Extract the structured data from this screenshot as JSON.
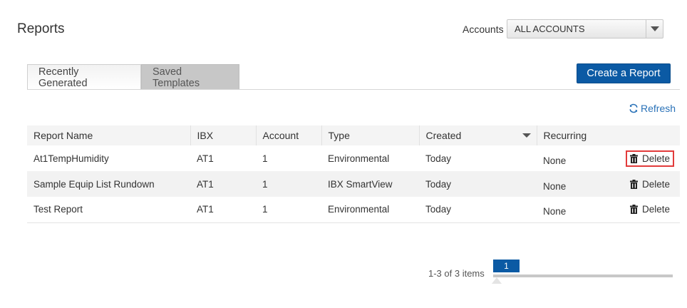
{
  "page": {
    "title": "Reports"
  },
  "accounts": {
    "label": "Accounts",
    "selected": "ALL ACCOUNTS"
  },
  "tabs": [
    {
      "label": "Recently Generated",
      "active": true
    },
    {
      "label": "Saved Templates",
      "active": false
    }
  ],
  "toolbar": {
    "create_label": "Create a Report",
    "refresh_label": "Refresh"
  },
  "table": {
    "columns": [
      "Report Name",
      "IBX",
      "Account",
      "Type",
      "Created",
      "Recurring"
    ],
    "rows": [
      {
        "name": "At1TempHumidity",
        "ibx": "AT1",
        "account": "1",
        "type": "Environmental",
        "created": "Today",
        "recurring": "None",
        "action": "Delete"
      },
      {
        "name": "Sample Equip List Rundown",
        "ibx": "AT1",
        "account": "1",
        "type": "IBX SmartView",
        "created": "Today",
        "recurring": "None",
        "action": "Delete"
      },
      {
        "name": "Test Report",
        "ibx": "AT1",
        "account": "1",
        "type": "Environmental",
        "created": "Today",
        "recurring": "None",
        "action": "Delete"
      }
    ]
  },
  "pagination": {
    "summary": "1-3 of 3 items",
    "current_page": "1"
  },
  "colors": {
    "primary": "#0b5aa4",
    "link": "#2a72b8",
    "highlight": "#e23b3b"
  }
}
